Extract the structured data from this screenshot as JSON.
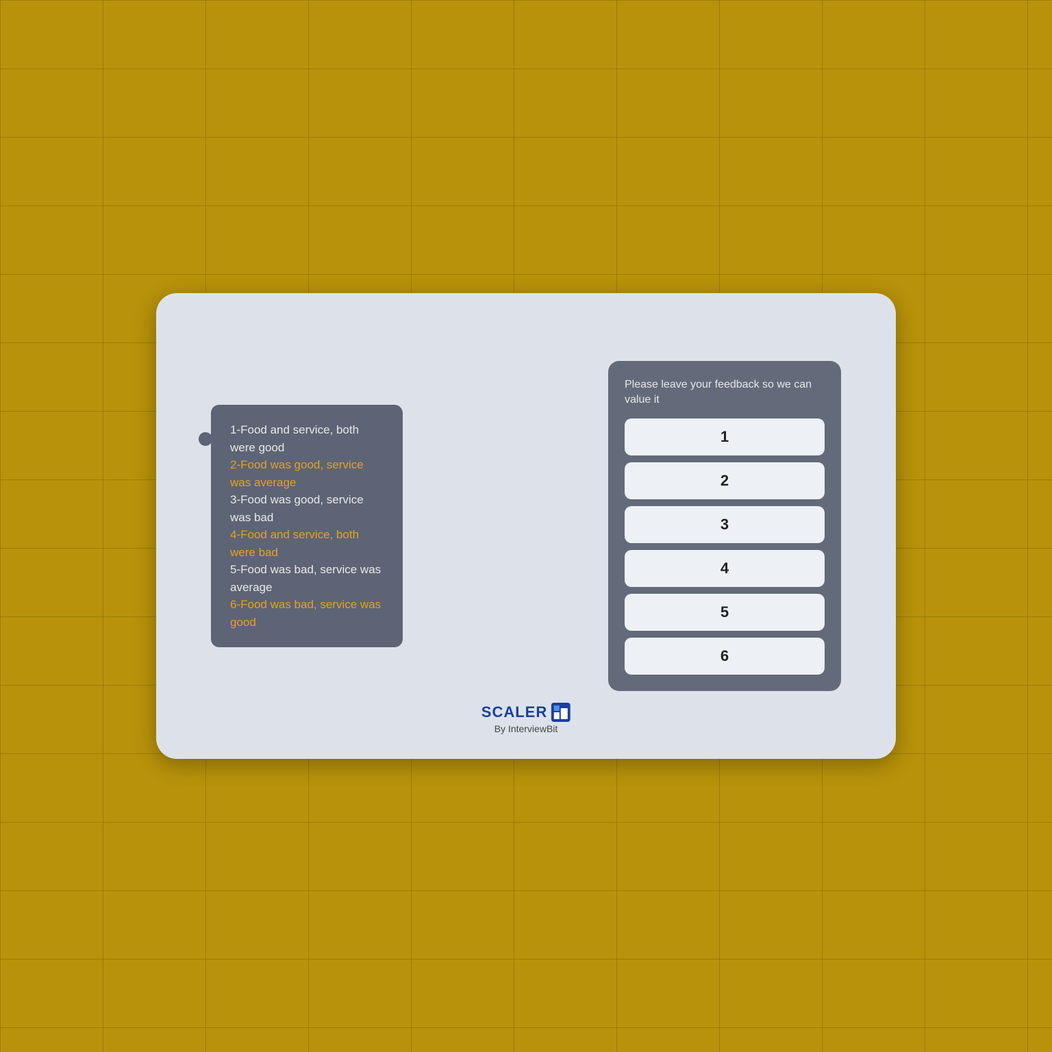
{
  "background": {
    "color": "#b8920a"
  },
  "card": {
    "bg_color": "#dde2ea"
  },
  "options_bubble": {
    "bg_color": "#5d6475",
    "items": [
      {
        "id": 1,
        "text": "1-Food and service, both were good",
        "highlight": false
      },
      {
        "id": 2,
        "text": "2-Food was good, service was average",
        "highlight": true
      },
      {
        "id": 3,
        "text": "3-Food was good, service was bad",
        "highlight": false
      },
      {
        "id": 4,
        "text": "4-Food and service, both were bad",
        "highlight": true
      },
      {
        "id": 5,
        "text": "5-Food was bad, service was average",
        "highlight": false
      },
      {
        "id": 6,
        "text": "6-Food was bad, service was good",
        "highlight": true
      }
    ]
  },
  "feedback_panel": {
    "title": "Please leave your feedback so we can value it",
    "buttons": [
      {
        "label": "1"
      },
      {
        "label": "2"
      },
      {
        "label": "3"
      },
      {
        "label": "4"
      },
      {
        "label": "5"
      },
      {
        "label": "6"
      }
    ]
  },
  "branding": {
    "name": "SCALER",
    "sub": "By InterviewBit"
  }
}
